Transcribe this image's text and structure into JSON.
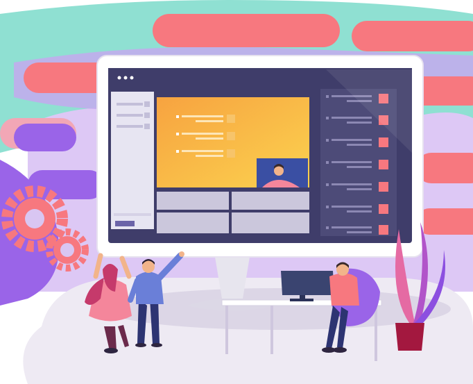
{
  "illustration": {
    "window_dots": [
      "dot",
      "dot",
      "dot"
    ],
    "colors": {
      "teal": "#8fe0d2",
      "coral": "#f7787f",
      "pink": "#f2a7b6",
      "purple": "#9a64e8",
      "lavender": "#d9c6f2",
      "monitor_frame": "#ffffff",
      "screen_dark": "#3f3d6a",
      "sidebar_dark": "#4d4b78",
      "orange": "#f7a340",
      "yellow": "#fbd24f",
      "video_blue": "#3a4fa3",
      "gear": "#f7787f",
      "plant": "#b154c9",
      "pot": "#a3183f"
    },
    "icons": [
      "gear-icon",
      "gear-icon",
      "plant-icon",
      "monitor-icon",
      "desktop-computer-icon"
    ]
  }
}
